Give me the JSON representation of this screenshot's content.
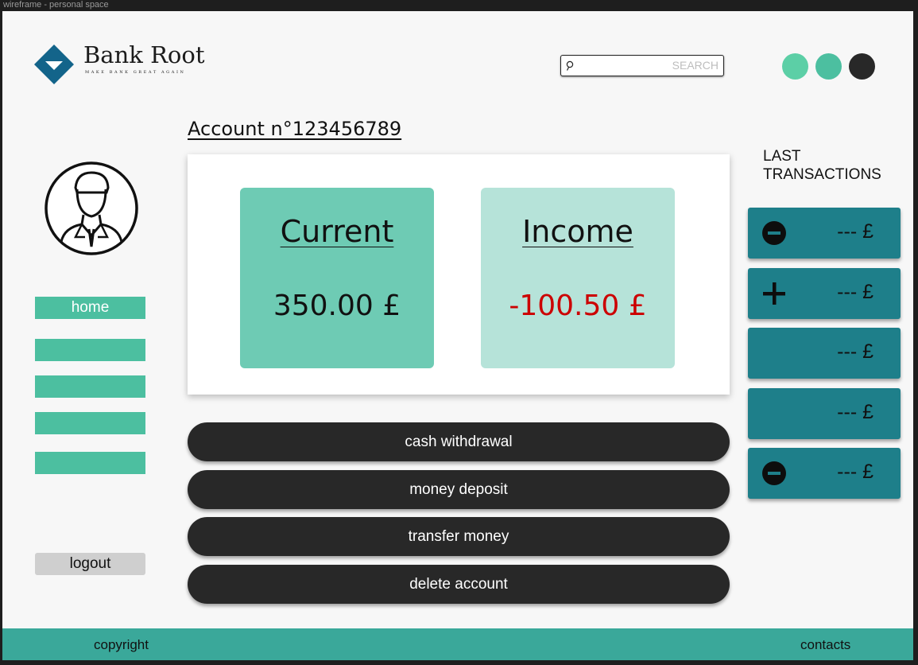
{
  "frame_label": "wireframe - personal space",
  "brand": {
    "name": "Bank Root",
    "tagline": "MAKE BANK GREAT AGAIN",
    "color": "#13648a"
  },
  "search": {
    "placeholder": "SEARCH"
  },
  "theme_dots": [
    "#5ccfa6",
    "#4cbfa0",
    "#282828"
  ],
  "account": {
    "title": "Account n°123456789"
  },
  "nav": {
    "items": [
      "home",
      "",
      "",
      "",
      ""
    ],
    "logout": "logout"
  },
  "cards": {
    "current": {
      "title": "Current",
      "value": "350.00 £"
    },
    "income": {
      "title": "Income",
      "value": "-100.50 £",
      "value_color": "#cc0000"
    }
  },
  "actions": [
    "cash withdrawal",
    "money deposit",
    "transfer money",
    "delete account"
  ],
  "transactions": {
    "title": "LAST TRANSACTIONS",
    "items": [
      {
        "icon": "minus-circle-icon",
        "amount": "--- £"
      },
      {
        "icon": "plus-icon",
        "amount": "--- £"
      },
      {
        "icon": "none",
        "amount": "--- £"
      },
      {
        "icon": "none",
        "amount": "--- £"
      },
      {
        "icon": "minus-circle-icon",
        "amount": "--- £"
      }
    ]
  },
  "footer": {
    "left": "copyright",
    "right": "contacts"
  }
}
